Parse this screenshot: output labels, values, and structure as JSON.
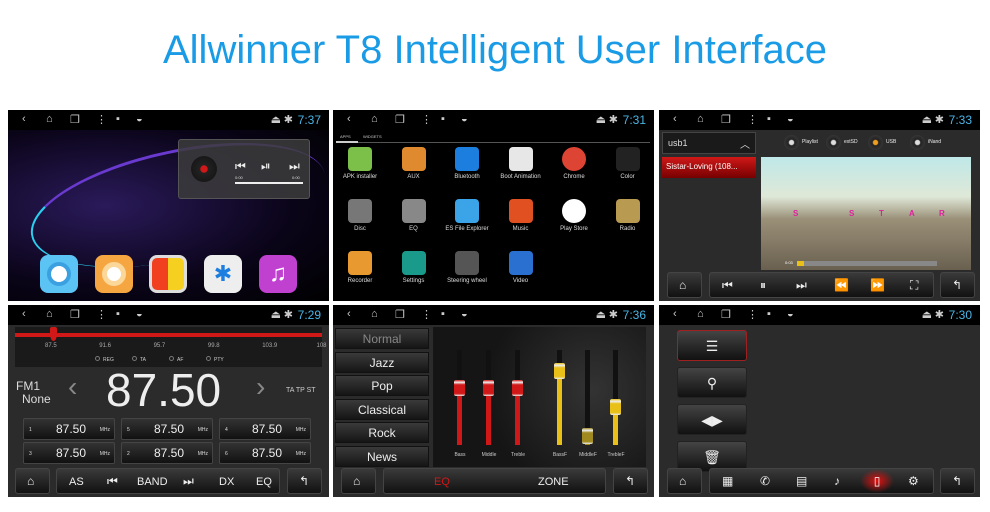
{
  "title": "Allwinner T8 Intelligent User Interface",
  "colors": {
    "title": "#1a9be6",
    "time": "#4ab4e6",
    "accent_red": "#d0101a"
  },
  "status_icons": [
    "back-icon",
    "home-icon",
    "recents-icon",
    "menu-icon",
    "image-icon",
    "wifi-icon",
    "eject-icon",
    "bluetooth-icon"
  ],
  "home": {
    "time": "7:37",
    "widget": {
      "elapsed": "0:00",
      "total": "0:00"
    },
    "dock": [
      "navigation",
      "settings-dial",
      "colors",
      "bluetooth",
      "music"
    ]
  },
  "apps": {
    "time": "7:31",
    "tabs": [
      "APPS",
      "WIDGETS"
    ],
    "items": [
      {
        "label": "APK installer",
        "color": "#7cc04a"
      },
      {
        "label": "AUX",
        "color": "#e08a30"
      },
      {
        "label": "Bluetooth",
        "color": "#1c7fe0"
      },
      {
        "label": "Boot Animation",
        "color": "#e7e7e7"
      },
      {
        "label": "Chrome",
        "color": "#dd4433"
      },
      {
        "label": "Color",
        "color": "#222"
      },
      {
        "label": "Disc",
        "color": "#777"
      },
      {
        "label": "EQ",
        "color": "#888"
      },
      {
        "label": "ES File Explorer",
        "color": "#3ba4e8"
      },
      {
        "label": "Music",
        "color": "#e05020"
      },
      {
        "label": "Play Store",
        "color": "#fff"
      },
      {
        "label": "Radio",
        "color": "#b89a50"
      },
      {
        "label": "Recorder",
        "color": "#e89a30"
      },
      {
        "label": "Settings",
        "color": "#1a9a8a"
      },
      {
        "label": "Steering wheel",
        "color": "#555"
      },
      {
        "label": "Video",
        "color": "#2a70d0"
      }
    ]
  },
  "video": {
    "time": "7:33",
    "folder": "usb1",
    "track": "Sistar-Loving (108...",
    "sources": [
      {
        "label": "Playlist",
        "active": false
      },
      {
        "label": "extSD",
        "active": false
      },
      {
        "label": "USB",
        "active": true
      },
      {
        "label": "iNand",
        "active": false
      }
    ],
    "overlay_letters": [
      "S",
      "S",
      "T",
      "A",
      "R"
    ],
    "position": "0:03",
    "progress": 0.05
  },
  "radio": {
    "time": "7:29",
    "scale": [
      "87.5",
      "91.6",
      "95.7",
      "99.8",
      "103.9",
      "108"
    ],
    "options": [
      "REG",
      "TA",
      "AF",
      "PTY"
    ],
    "band": "FM1",
    "name": "None",
    "frequency": "87.50",
    "flags": "TA TP ST",
    "presets": [
      {
        "n": "1",
        "f": "87.50",
        "u": "MHz"
      },
      {
        "n": "3",
        "f": "87.50",
        "u": "MHz"
      },
      {
        "n": "5",
        "f": "87.50",
        "u": "MHz"
      },
      {
        "n": "2",
        "f": "87.50",
        "u": "MHz"
      },
      {
        "n": "4",
        "f": "87.50",
        "u": "MHz"
      },
      {
        "n": "6",
        "f": "87.50",
        "u": "MHz"
      }
    ],
    "buttons": [
      "AS",
      "BAND",
      "DX",
      "EQ"
    ]
  },
  "eq": {
    "time": "7:36",
    "presets": [
      "Normal",
      "Jazz",
      "Pop",
      "Classical",
      "Rock",
      "News"
    ],
    "sliders": [
      {
        "label": "Bass",
        "level": 0.6,
        "color": "#d01818"
      },
      {
        "label": "Middle",
        "level": 0.6,
        "color": "#d01818"
      },
      {
        "label": "Treble",
        "level": 0.6,
        "color": "#d01818"
      },
      {
        "label": "BassF",
        "level": 0.78,
        "color": "#e8c018"
      },
      {
        "label": "MiddleF",
        "level": 0.1,
        "color": "#a08a20"
      },
      {
        "label": "TrebleF",
        "level": 0.4,
        "color": "#e8c018"
      }
    ],
    "tabs": [
      "EQ",
      "ZONE"
    ]
  },
  "bt": {
    "time": "7:30"
  }
}
